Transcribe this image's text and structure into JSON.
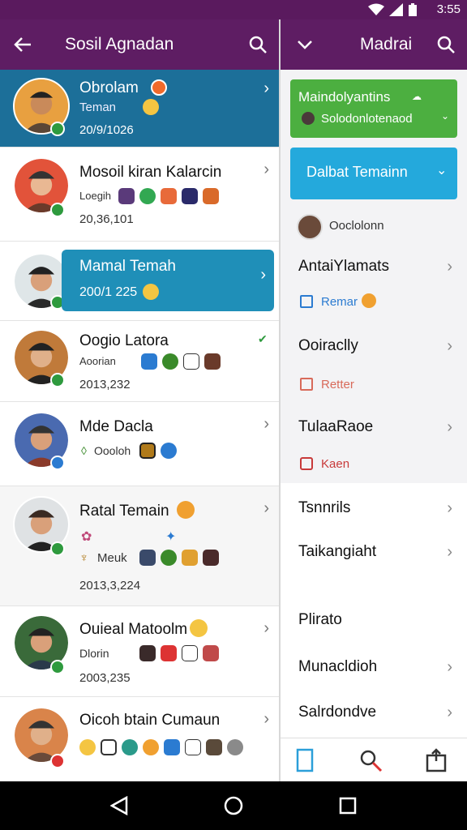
{
  "status": {
    "time": "3:55"
  },
  "left_bar": {
    "title": "Sosil Agnadan"
  },
  "right_bar": {
    "title": "Madrai"
  },
  "contacts": [
    {
      "name": "Obrolam",
      "sub": "Teman",
      "num": "20/9/1026",
      "selected": true
    },
    {
      "name": "Mosoil kiran Kalarcin",
      "sub": "Loegih",
      "num": "20,36,101"
    },
    {
      "name": "Mamal Temah",
      "num": "200/1 225",
      "highlight": true
    },
    {
      "name": "Oogio Latora",
      "sub": "Aoorian",
      "num": "2013,232"
    },
    {
      "name": "Mde Dacla",
      "sub": "Oooloh"
    },
    {
      "name": "Ratal Temain",
      "sub": "Meuk",
      "num": "2013,3,224"
    },
    {
      "name": "Ouieal Matoolm",
      "sub": "Dlorin",
      "num": "2003,235"
    },
    {
      "name": "Oicoh btain Cumaun"
    }
  ],
  "right_panel": {
    "green_card": {
      "title": "Maindolyantins",
      "sub": "Solodonlotenaod"
    },
    "blue_card": {
      "title": "Dalbat Temainn"
    },
    "profile_name": "Ooclolonn",
    "items": [
      {
        "label": "AntaiYlamats",
        "sub": "Remar"
      },
      {
        "label": "Ooiraclly",
        "sub": "Retter"
      },
      {
        "label": "TulaaRaoe",
        "sub": "Kaen"
      },
      {
        "label": "Tsnnrils"
      },
      {
        "label": "Taikangiaht"
      },
      {
        "label": "Plirato"
      },
      {
        "label": "Munacldioh"
      },
      {
        "label": "Salrdondve"
      }
    ]
  },
  "colors": {
    "primary": "#5e1d63",
    "selected": "#1c6f99",
    "highlight": "#1f8fb8",
    "green": "#4caf40",
    "cyan": "#24a9dc"
  }
}
